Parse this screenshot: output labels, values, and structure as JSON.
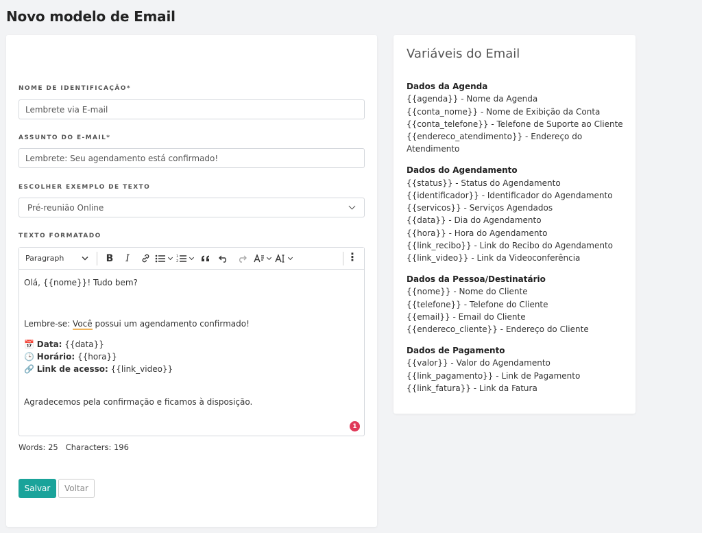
{
  "page": {
    "title": "Novo modelo de Email"
  },
  "form": {
    "name_label": "NOME DE IDENTIFICAÇÃO*",
    "name_value": "Lembrete via E-mail",
    "subject_label": "ASSUNTO DO E-MAIL*",
    "subject_value": "Lembrete: Seu agendamento está confirmado!",
    "example_label": "ESCOLHER EXEMPLO DE TEXTO",
    "example_selected": "Pré-reunião Online",
    "formatted_label": "TEXTO FORMATADO"
  },
  "editor": {
    "toolbar": {
      "paragraph": "Paragraph",
      "bold": "B",
      "italic": "I",
      "icons": [
        "chevron-down-icon",
        "link-icon",
        "bulleted-list-icon",
        "numbered-list-icon",
        "quote-icon",
        "undo-icon",
        "redo-icon",
        "font-size-icon",
        "text-case-icon",
        "more-vertical-icon"
      ]
    },
    "content": {
      "greeting": "Olá, {{nome}}! Tudo bem?",
      "reminder_prefix": "Lembre-se",
      "reminder_colon": ": ",
      "reminder_word": "Você",
      "reminder_rest": " possui um agendamento confirmado!",
      "date_emoji": "📅",
      "date_label": "Data:",
      "date_value": " {{data}}",
      "time_emoji": "🕒",
      "time_label": "Horário:",
      "time_value": " {{hora}}",
      "link_emoji": "🔗",
      "link_label": "Link de acesso:",
      "link_value": " {{link_video}}",
      "closing": "Agradecemos pela confirmação e ficamos à disposição."
    },
    "badge": "1"
  },
  "counts": {
    "words": "Words: 25",
    "characters": "Characters: 196"
  },
  "buttons": {
    "save": "Salvar",
    "back": "Voltar"
  },
  "variables": {
    "title": "Variáveis do Email",
    "groups": [
      {
        "heading": "Dados da Agenda",
        "lines": [
          "{{agenda}} - Nome da Agenda",
          "{{conta_nome}} - Nome de Exibição da Conta",
          "{{conta_telefone}} - Telefone de Suporte ao Cliente",
          "{{endereco_atendimento}} - Endereço do",
          "Atendimento"
        ]
      },
      {
        "heading": "Dados do Agendamento",
        "lines": [
          "{{status}} - Status do Agendamento",
          "{{identificador}} - Identificador do Agendamento",
          "{{servicos}} - Serviços Agendados",
          "{{data}} - Dia do Agendamento",
          "{{hora}} - Hora do Agendamento",
          "{{link_recibo}} - Link do Recibo do Agendamento",
          "{{link_video}} - Link da Videoconferência"
        ]
      },
      {
        "heading": "Dados da Pessoa/Destinatário",
        "lines": [
          "{{nome}} - Nome do Cliente",
          "{{telefone}} - Telefone do Cliente",
          "{{email}} - Email do Cliente",
          "{{endereco_cliente}} - Endereço do Cliente"
        ]
      },
      {
        "heading": "Dados de Pagamento",
        "lines": [
          "{{valor}} - Valor do Agendamento",
          "{{link_pagamento}} - Link de Pagamento",
          "{{link_fatura}} - Link da Fatura"
        ]
      }
    ]
  }
}
